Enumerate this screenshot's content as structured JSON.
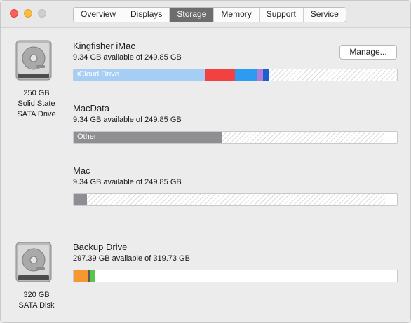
{
  "tabs": [
    "Overview",
    "Displays",
    "Storage",
    "Memory",
    "Support",
    "Service"
  ],
  "disks": [
    {
      "caption": [
        "250 GB",
        "Solid State",
        "SATA Drive"
      ]
    },
    {
      "caption": [
        "320 GB",
        "SATA Disk"
      ]
    }
  ],
  "volumes": [
    {
      "name": "Kingfisher iMac",
      "available": "9.34 GB available of 249.85 GB",
      "manage_label": "Manage...",
      "bar_label": "iCloud Drive"
    },
    {
      "name": "MacData",
      "available": "9.34 GB available of 249.85 GB",
      "bar_label": "Other"
    },
    {
      "name": "Mac",
      "available": "9.34 GB available of 249.85 GB"
    },
    {
      "name": "Backup Drive",
      "available": "297.39 GB available of 319.73 GB"
    }
  ],
  "colors": {
    "icloud": "#a6cdf4",
    "red": "#f14140",
    "blue": "#2d9cf0",
    "purple": "#b07cd6",
    "darkblue": "#1b5fd1",
    "other": "#8e8e93",
    "orange": "#f7972f",
    "green": "#5ac54d"
  }
}
